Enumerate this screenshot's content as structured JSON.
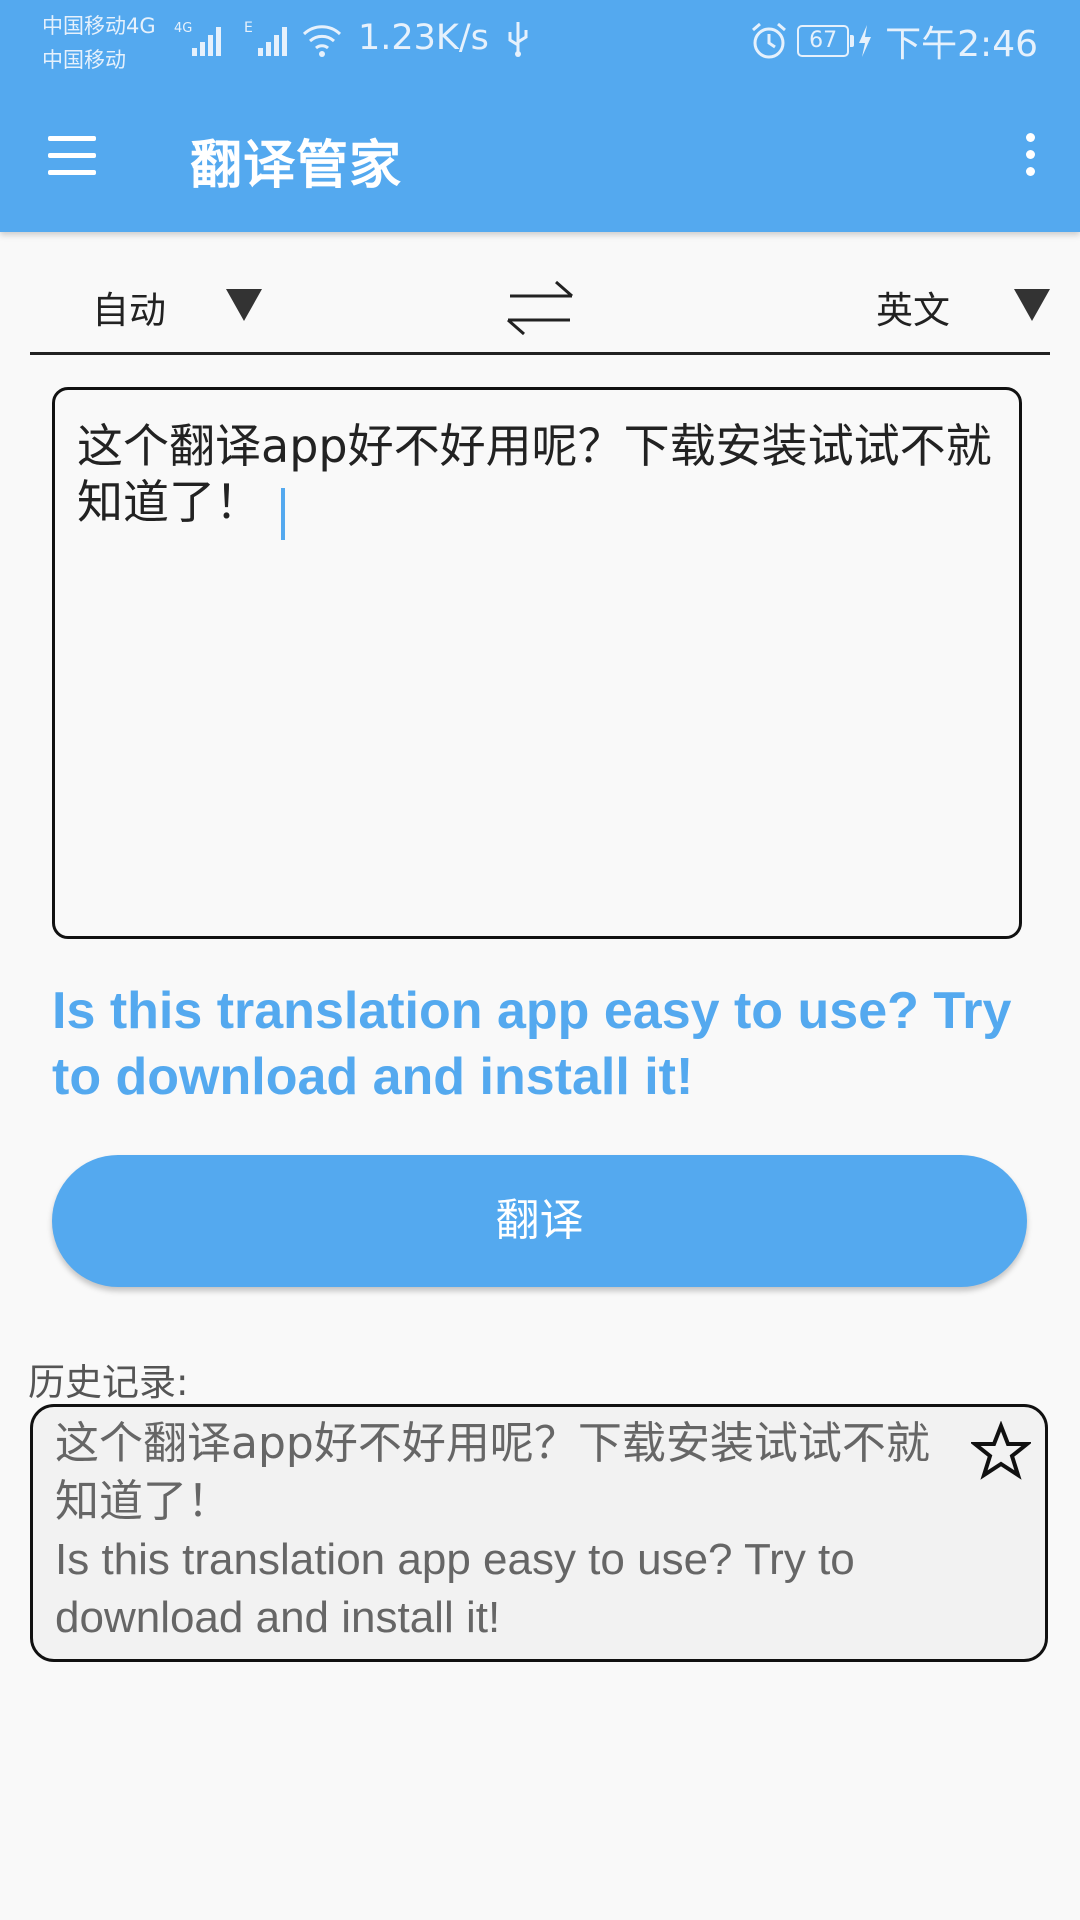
{
  "status_bar": {
    "carrier1": "中国移动4G",
    "carrier2": "中国移动",
    "net_speed": "1.23K/s",
    "battery": "67",
    "time": "下午2:46"
  },
  "app_bar": {
    "title": "翻译管家",
    "menu_icon": "hamburger-menu-icon",
    "more_icon": "more-vert-icon",
    "color": "#54a9ef"
  },
  "language": {
    "source": "自动",
    "target": "英文",
    "swap_icon": "swap-arrows-icon"
  },
  "input": {
    "text": "这个翻译app好不好用呢？下载安装试试不就知道了！"
  },
  "result": {
    "text": "Is this translation app easy to use? Try to download and install it!"
  },
  "translate_button": {
    "label": "翻译"
  },
  "history": {
    "label": "历史记录:",
    "items": [
      {
        "source": "这个翻译app好不好用呢？下载安装试试不就知道了！",
        "translation": "Is this translation app easy to use? Try to download and install it!",
        "icon": "star-outline-icon"
      }
    ]
  }
}
